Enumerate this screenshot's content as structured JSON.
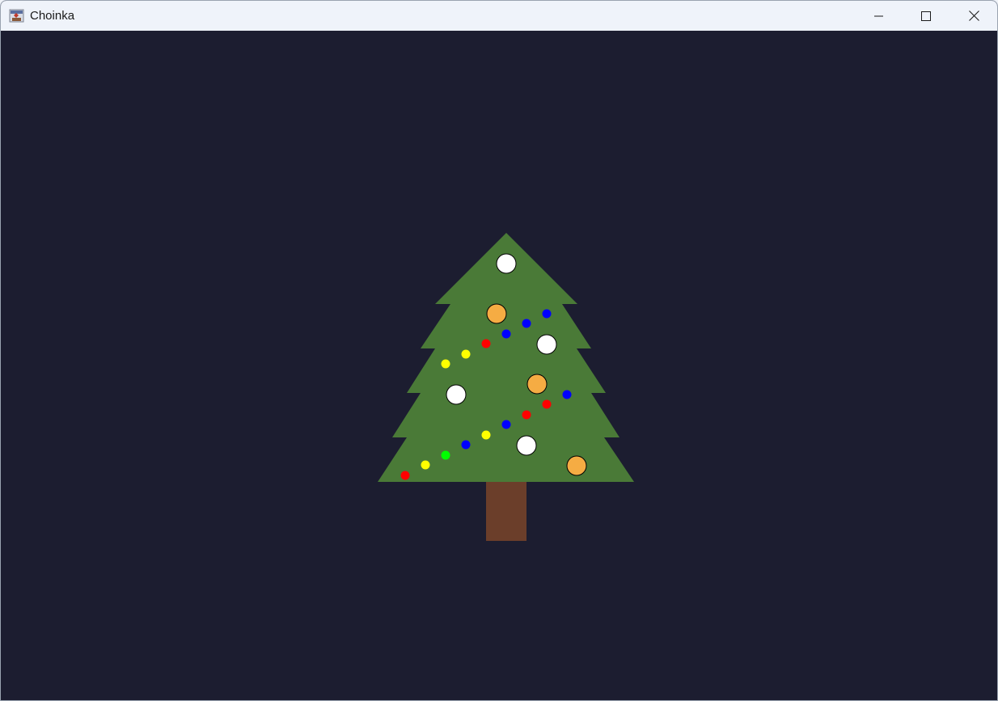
{
  "window": {
    "title": "Choinka",
    "app_icon": "java-coffee-icon",
    "controls": {
      "minimize_icon": "minimize-icon",
      "maximize_icon": "maximize-icon",
      "close_icon": "close-icon"
    }
  },
  "scene": {
    "background_color": "#1c1d30",
    "tree_color": "#4a7a37",
    "trunk_color": "#6b3e2a",
    "ornament_colors": {
      "white": "#ffffff",
      "orange": "#f5ac43",
      "red": "#ff0000",
      "blue": "#0000ff",
      "yellow": "#ffff00",
      "green": "#00ff00"
    },
    "ornaments": [
      {
        "kind": "bauble",
        "color": "white"
      },
      {
        "kind": "bauble",
        "color": "orange"
      },
      {
        "kind": "light",
        "color": "blue"
      },
      {
        "kind": "light",
        "color": "blue"
      },
      {
        "kind": "light",
        "color": "blue"
      },
      {
        "kind": "bauble",
        "color": "white"
      },
      {
        "kind": "light",
        "color": "red"
      },
      {
        "kind": "light",
        "color": "yellow"
      },
      {
        "kind": "light",
        "color": "yellow"
      },
      {
        "kind": "bauble",
        "color": "orange"
      },
      {
        "kind": "bauble",
        "color": "white"
      },
      {
        "kind": "light",
        "color": "blue"
      },
      {
        "kind": "light",
        "color": "red"
      },
      {
        "kind": "light",
        "color": "red"
      },
      {
        "kind": "light",
        "color": "blue"
      },
      {
        "kind": "light",
        "color": "yellow"
      },
      {
        "kind": "bauble",
        "color": "white"
      },
      {
        "kind": "light",
        "color": "blue"
      },
      {
        "kind": "light",
        "color": "green"
      },
      {
        "kind": "bauble",
        "color": "orange"
      },
      {
        "kind": "light",
        "color": "yellow"
      },
      {
        "kind": "light",
        "color": "red"
      }
    ]
  }
}
